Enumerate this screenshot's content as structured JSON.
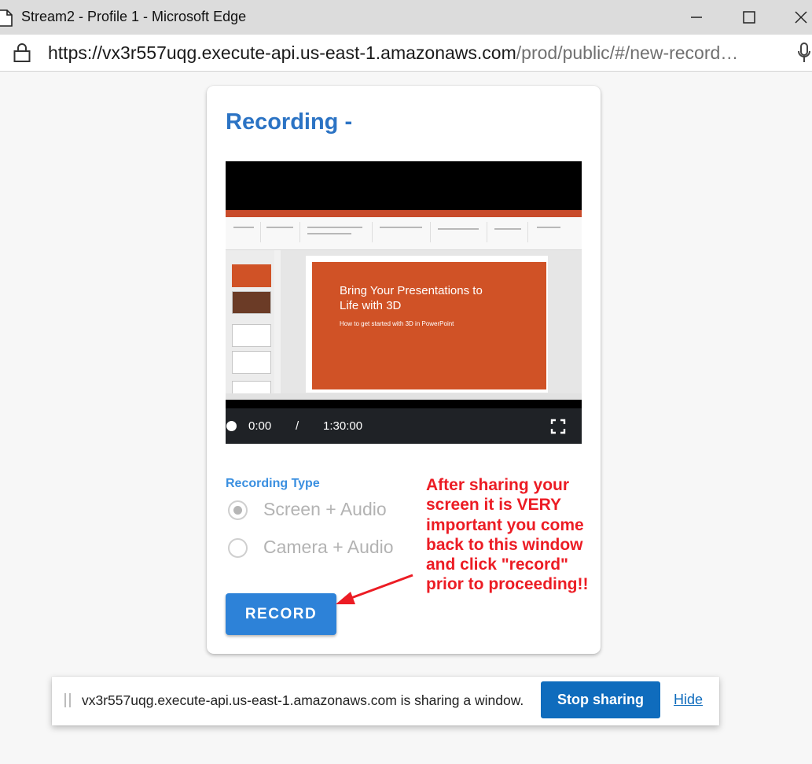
{
  "browser": {
    "window_title": "Stream2 - Profile 1 - Microsoft Edge",
    "url_host": "https://vx3r557uqg.execute-api.us-east-1.amazonaws.com",
    "url_path": "/prod/public/#/new-record…"
  },
  "card": {
    "title": "Recording -",
    "player": {
      "current_time": "0:00",
      "separator": "/",
      "duration": "1:30:00",
      "preview_slide_title": "Bring Your Presentations to Life with 3D",
      "preview_slide_subtitle": "How to get started with 3D in PowerPoint"
    },
    "recording_type_label": "Recording Type",
    "options": [
      {
        "label": "Screen + Audio",
        "selected": true
      },
      {
        "label": "Camera + Audio",
        "selected": false
      }
    ],
    "record_button": "RECORD"
  },
  "annotation": {
    "text": "After sharing your screen it is VERY important you come back to this window and click \"record\" prior to proceeding!!",
    "color": "#ec1c24"
  },
  "sharing_bar": {
    "message": "vx3r557uqg.execute-api.us-east-1.amazonaws.com is sharing a window.",
    "stop_button": "Stop sharing",
    "hide_link": "Hide"
  },
  "colors": {
    "accent": "#2b73c4",
    "record_button": "#2d82d8",
    "stop_button": "#0f6cbd"
  }
}
